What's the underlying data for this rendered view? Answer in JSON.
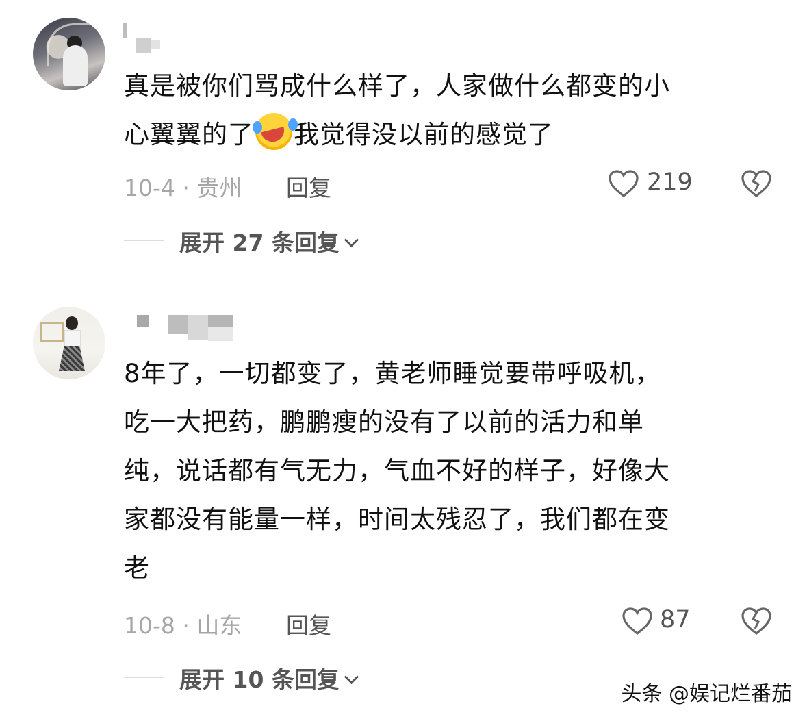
{
  "comments": [
    {
      "text_line1": "真是被你们骂成什么样了，人家做什么都变的小",
      "text_line2_a": "心翼翼的了",
      "text_line2_emoji": "crying-laughing-emoji",
      "text_line2_b": "我觉得没以前的感觉了",
      "date_location": "10-4 · 贵州",
      "reply_label": "回复",
      "likes": "219",
      "expand_label": "展开 27 条回复"
    },
    {
      "lines": [
        "8年了，一切都变了，黄老师睡觉要带呼吸机，",
        "吃一大把药，鹏鹏瘦的没有了以前的活力和单",
        "纯，说话都有气无力，气血不好的样子，好像大",
        "家都没有能量一样，时间太残忍了，我们都在变",
        "老"
      ],
      "date_location": "10-8 · 山东",
      "reply_label": "回复",
      "likes": "87",
      "expand_label": "展开 10 条回复"
    }
  ],
  "watermark": "头条 @娱记烂番茄",
  "icons": {
    "like": "heart-outline-icon",
    "dislike": "broken-heart-icon",
    "expand": "chevron-down-icon"
  }
}
